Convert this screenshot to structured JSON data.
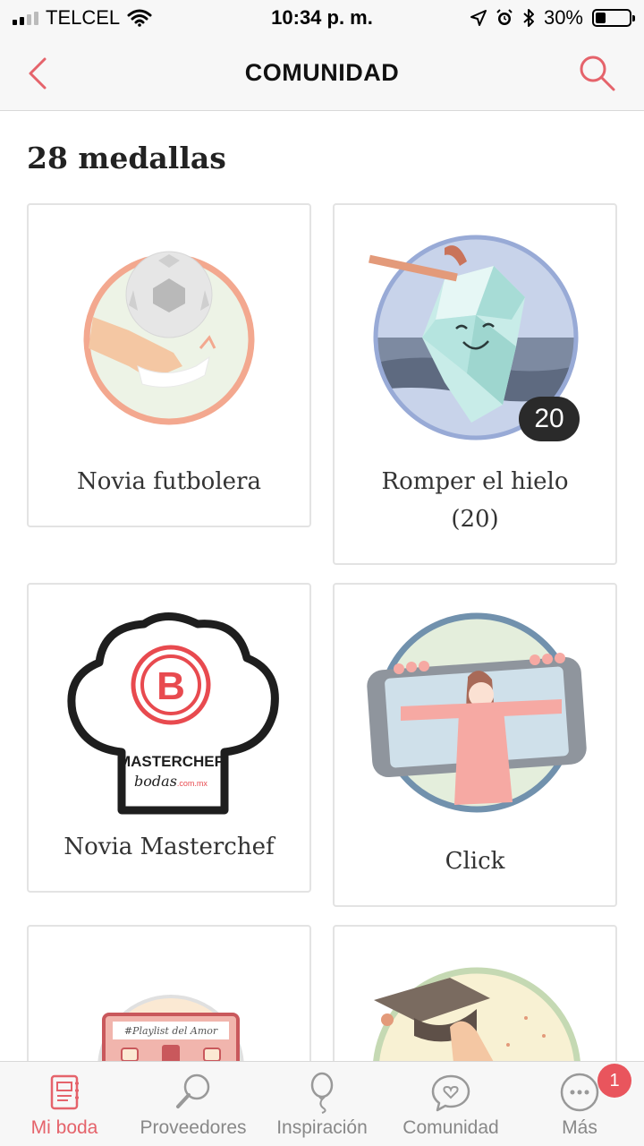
{
  "status_bar": {
    "carrier": "TELCEL",
    "time": "10:34 p. m.",
    "battery_percent": "30%",
    "battery_level": 0.3
  },
  "nav": {
    "title": "COMUNIDAD",
    "back_icon": "chevron-left-icon",
    "search_icon": "search-icon"
  },
  "section_title": "28 medallas",
  "medals": [
    {
      "label": "Novia futbolera",
      "label2": ""
    },
    {
      "label": "Romper el hielo",
      "label2": "(20)",
      "count_badge": "20"
    },
    {
      "label": "Novia Masterchef",
      "label2": "",
      "logo_text_1": "MASTERCHEF",
      "logo_text_2": "bodas",
      "logo_text_3": ".com.mx"
    },
    {
      "label": "Click",
      "label2": ""
    },
    {
      "label": "",
      "label2": "",
      "sign_text": "#Playlist del Amor"
    },
    {
      "label": "",
      "label2": ""
    }
  ],
  "tabs": [
    {
      "label": "Mi boda",
      "icon": "notebook-icon",
      "active": true
    },
    {
      "label": "Proveedores",
      "icon": "magnifier-icon"
    },
    {
      "label": "Inspiración",
      "icon": "balloon-icon"
    },
    {
      "label": "Comunidad",
      "icon": "chat-heart-icon"
    },
    {
      "label": "Más",
      "icon": "more-dots-icon",
      "notification": "1"
    }
  ],
  "colors": {
    "accent": "#e5636b",
    "badge_bg": "#2a2a2a",
    "notification": "#e9555d"
  }
}
